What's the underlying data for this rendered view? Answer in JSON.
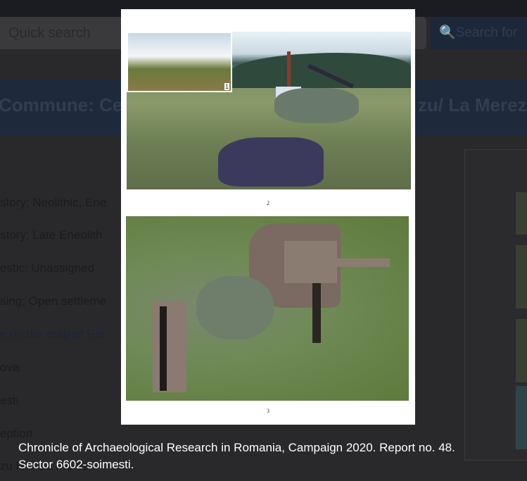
{
  "background_page": {
    "search": {
      "placeholder": "Quick search",
      "button_label": "Search for",
      "button_icon": "search-icon"
    },
    "title_left": "Commune: Cept",
    "title_right": "zu/ La Merez |",
    "facts": [
      {
        "text": "story; Neolithic, Ene",
        "link": false
      },
      {
        "text": "story;  Late Eneolith",
        "link": false
      },
      {
        "text": "estic;  Unassigned",
        "link": false
      },
      {
        "text": "sing;  Open settleme",
        "link": false
      },
      {
        "text": "e on the map of Ror",
        "link": true
      },
      {
        "text": "ova",
        "link": false
      },
      {
        "text": "esti",
        "link": false
      },
      {
        "text": "eption",
        "link": false
      },
      {
        "text": "zu Hill/ La Merez",
        "link": false
      }
    ]
  },
  "lightbox": {
    "figure_labels": {
      "inset": "1",
      "photo_top": "2",
      "photo_bottom": "3"
    },
    "caption_line1": "Chronicle of Archaeological Research in Romania, Campaign 2020. Report no. 48.",
    "caption_line2": "Sector 6602-soimesti."
  }
}
